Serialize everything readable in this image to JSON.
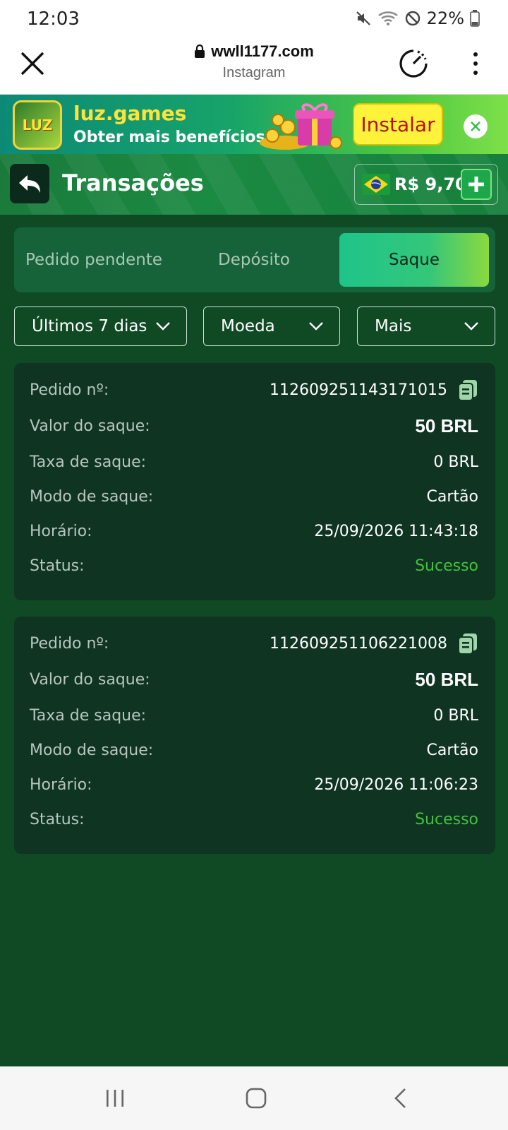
{
  "status_bar": {
    "time": "12:03",
    "battery": "22%"
  },
  "browser": {
    "url": "wwll1177.com",
    "source": "Instagram"
  },
  "banner": {
    "logo_text": "LUZ",
    "app_name": "luz.games",
    "tagline": "Obter mais benefícios",
    "install_label": "Instalar"
  },
  "header": {
    "title": "Transações",
    "balance": "R$ 9,70"
  },
  "tabs": [
    {
      "label": "Pedido pendente",
      "active": false
    },
    {
      "label": "Depósito",
      "active": false
    },
    {
      "label": "Saque",
      "active": true
    }
  ],
  "filters": [
    {
      "label": "Últimos 7 dias"
    },
    {
      "label": "Moeda"
    },
    {
      "label": "Mais"
    }
  ],
  "transactions": [
    {
      "order_label": "Pedido nº:",
      "order_no": "112609251143171015",
      "amount_label": "Valor do saque:",
      "amount": "50 BRL",
      "fee_label": "Taxa de saque:",
      "fee": "0 BRL",
      "mode_label": "Modo de saque:",
      "mode": "Cartão",
      "time_label": "Horário:",
      "time": "25/09/2026 11:43:18",
      "status_label": "Status:",
      "status": "Sucesso"
    },
    {
      "order_label": "Pedido nº:",
      "order_no": "112609251106221008",
      "amount_label": "Valor do saque:",
      "amount": "50 BRL",
      "fee_label": "Taxa de saque:",
      "fee": "0 BRL",
      "mode_label": "Modo de saque:",
      "mode": "Cartão",
      "time_label": "Horário:",
      "time": "25/09/2026 11:06:23",
      "status_label": "Status:",
      "status": "Sucesso"
    }
  ],
  "colors": {
    "background": "#0f4a25",
    "card": "#0f3422",
    "success": "#42c23e",
    "accent": "#1fc48a"
  }
}
